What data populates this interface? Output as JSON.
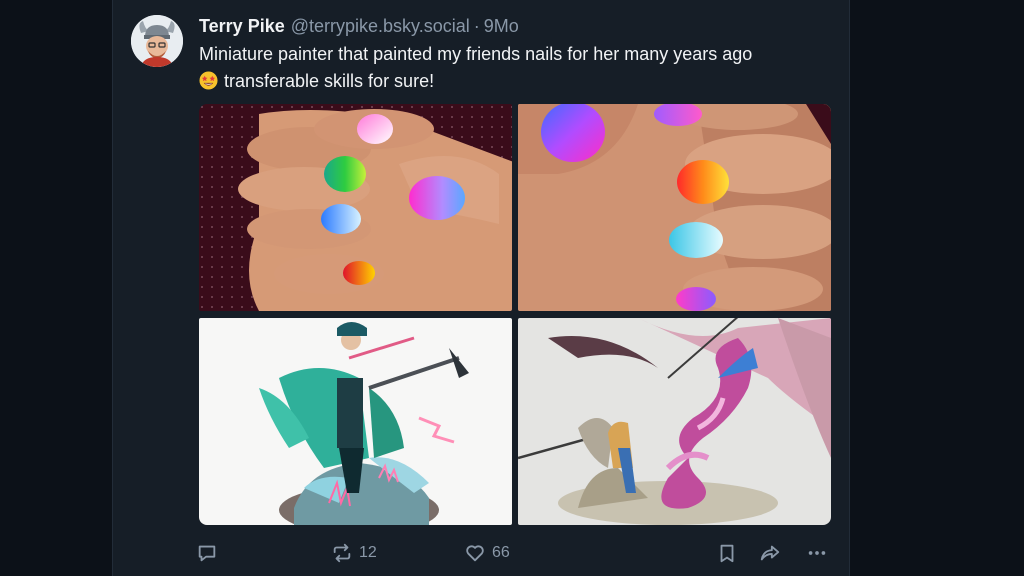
{
  "post": {
    "author_name": "Terry Pike",
    "author_handle": "@terrypike.bsky.social",
    "separator": "·",
    "time": "9Mo",
    "text_line1": "Miniature painter that painted my friends nails for her many years ago",
    "text_line2": "transferable skills for sure!",
    "emoji_icon": "star-struck-face-icon",
    "images": [
      {
        "alt": "",
        "subject": "hand with gradient painted nails"
      },
      {
        "alt": "",
        "subject": "hand with gradient painted nails"
      },
      {
        "alt": "",
        "subject": "painted miniature figure in teal cloak"
      },
      {
        "alt": "",
        "subject": "painted serpent daemon miniature"
      }
    ]
  },
  "actions": {
    "reply_count": "",
    "repost_count": "12",
    "like_count": "66"
  },
  "colors": {
    "background": "#0c1118",
    "column": "#161e27",
    "text": "#f1f3f5",
    "muted": "#8a98a8"
  }
}
